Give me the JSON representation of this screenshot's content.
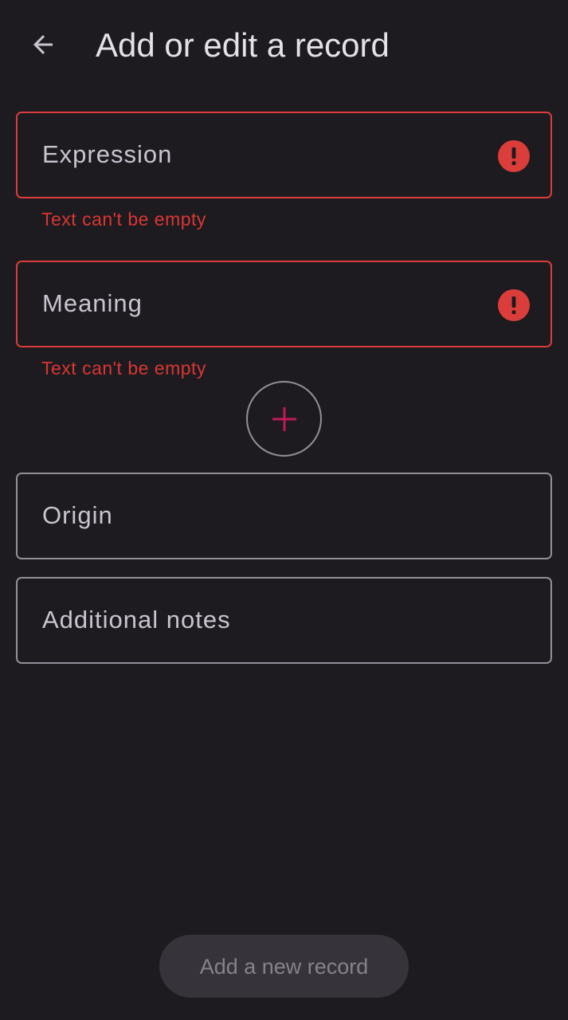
{
  "header": {
    "title": "Add or edit a record",
    "back_icon": "arrow-back-icon"
  },
  "form": {
    "expression": {
      "label": "Expression",
      "value": "",
      "error": "Text can't be empty",
      "error_icon": "error-icon"
    },
    "meaning": {
      "label": "Meaning",
      "value": "",
      "error": "Text can't be empty",
      "error_icon": "error-icon"
    },
    "add_meaning": {
      "icon": "plus-icon"
    },
    "origin": {
      "label": "Origin",
      "value": ""
    },
    "notes": {
      "label": "Additional notes",
      "value": ""
    }
  },
  "footer": {
    "submit_label": "Add a new record",
    "submit_enabled": false
  },
  "colors": {
    "background": "#1d1b20",
    "error": "#db3d3a",
    "accent": "#c2185b",
    "outline": "#938f99",
    "text": "#e6e0e9"
  }
}
